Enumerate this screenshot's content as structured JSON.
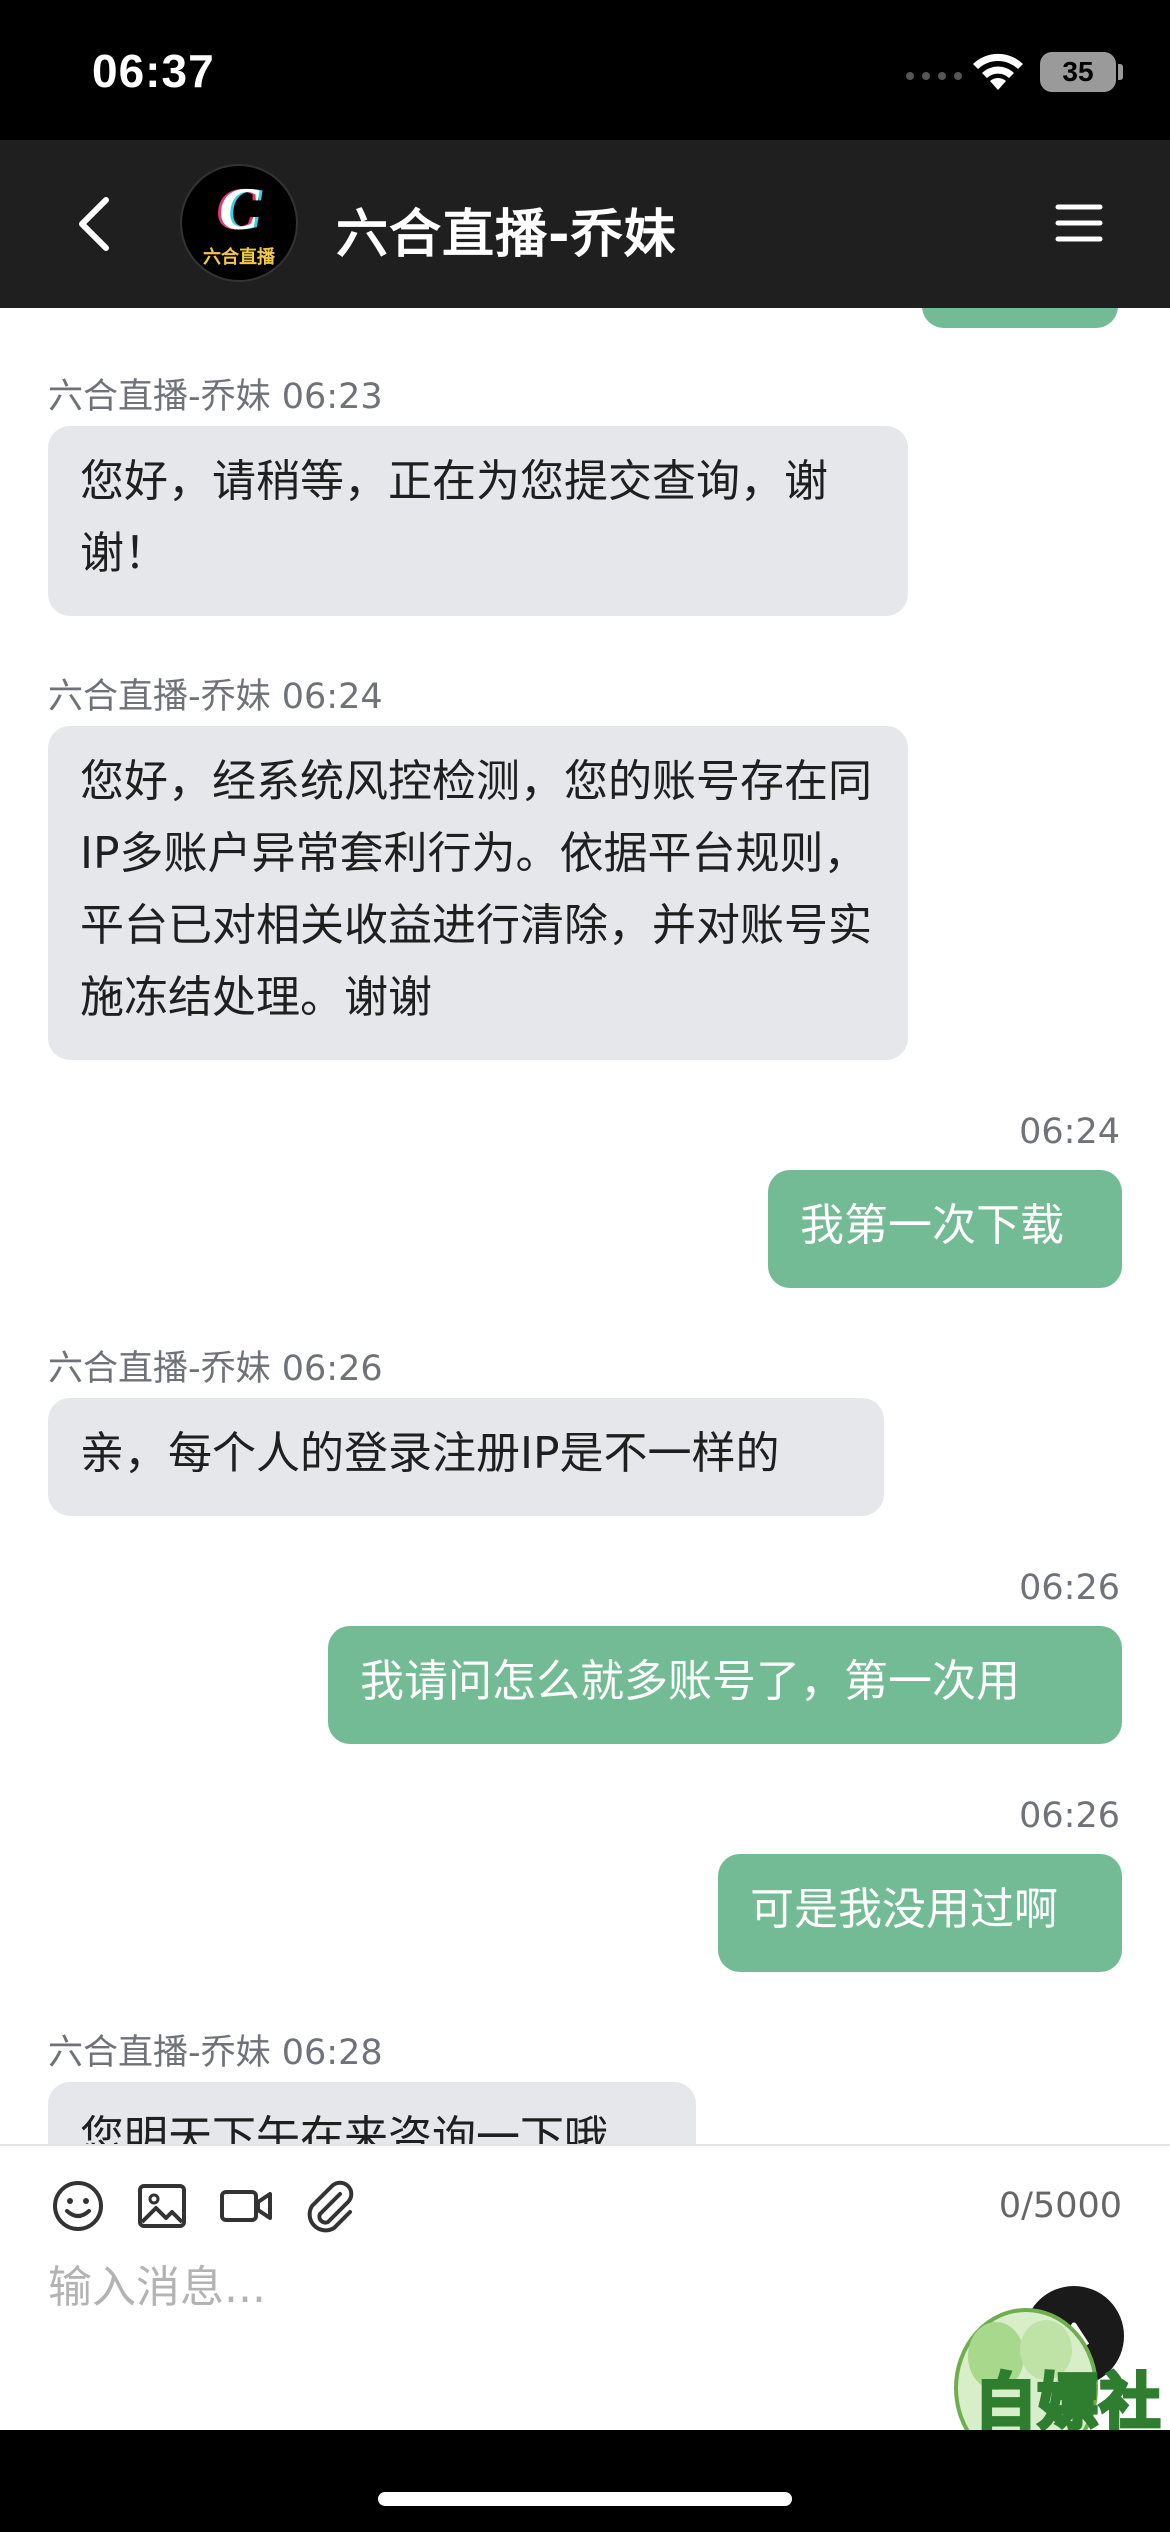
{
  "status_bar": {
    "time": "06:37",
    "battery": "35"
  },
  "header": {
    "title": "六合直播-乔妹",
    "avatar_label": "六合直播"
  },
  "messages": [
    {
      "side": "in",
      "meta": "六合直播-乔妹 06:23",
      "text": "您好，请稍等，正在为您提交查询，谢谢！"
    },
    {
      "side": "in",
      "meta": "六合直播-乔妹 06:24",
      "text": "您好，经系统风控检测，您的账号存在同IP多账户异常套利行为。依据平台规则，平台已对相关收益进行清除，并对账号实施冻结处理。谢谢"
    },
    {
      "side": "out",
      "meta": "06:24",
      "text": "我第一次下载"
    },
    {
      "side": "in",
      "meta": "六合直播-乔妹 06:26",
      "text": "亲，每个人的登录注册IP是不一样的"
    },
    {
      "side": "out",
      "meta": "06:26",
      "text": "我请问怎么就多账号了，第一次用"
    },
    {
      "side": "out",
      "meta": "06:26",
      "text": "可是我没用过啊"
    },
    {
      "side": "in",
      "meta": "六合直播-乔妹 06:28",
      "text": "您明天下午在来咨询一下哦"
    }
  ],
  "composer": {
    "counter": "0/5000",
    "placeholder": "输入消息..."
  },
  "watermark": {
    "text": "白嫖社"
  },
  "colors": {
    "header_bg": "#1f1f1f",
    "incoming_bubble": "#e6e7ea",
    "outgoing_bubble": "#73bb95"
  },
  "icons": [
    "back-icon",
    "menu-icon",
    "emoji-icon",
    "image-icon",
    "video-icon",
    "attachment-icon",
    "send-icon"
  ]
}
